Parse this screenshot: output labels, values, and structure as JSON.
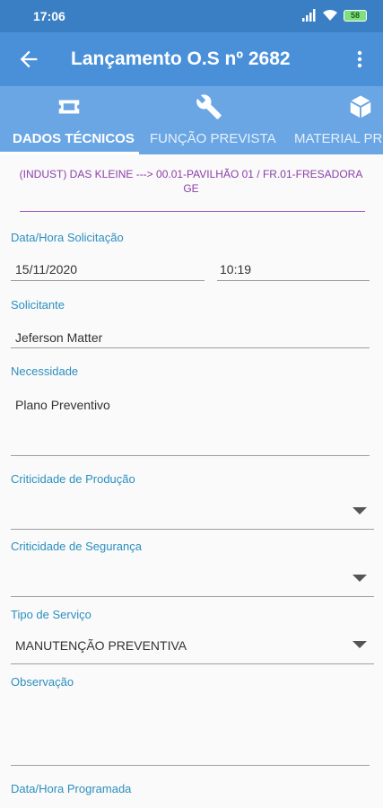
{
  "status_bar": {
    "time": "17:06",
    "battery": "58"
  },
  "app_bar": {
    "title": "Lançamento O.S nº 2682"
  },
  "tabs": [
    {
      "label": "DADOS TÉCNICOS",
      "icon": "ticket-icon"
    },
    {
      "label": "FUNÇÃO PREVISTA",
      "icon": "wrench-icon"
    },
    {
      "label": "MATERIAL PR",
      "icon": "box-icon"
    }
  ],
  "location": {
    "line1": "(INDUST) DAS KLEINE  ---> 00.01-PAVILHÃO 01 / FR.01-FRESADORA",
    "line2": "GE"
  },
  "form": {
    "datetime_label": "Data/Hora Solicitação",
    "date_value": "15/11/2020",
    "time_value": "10:19",
    "requester_label": "Solicitante",
    "requester_value": "Jeferson Matter",
    "need_label": "Necessidade",
    "need_value": "Plano Preventivo",
    "prod_crit_label": "Criticidade de Produção",
    "prod_crit_value": "",
    "safety_crit_label": "Criticidade de Segurança",
    "safety_crit_value": "",
    "service_type_label": "Tipo de Serviço",
    "service_type_value": "MANUTENÇÃO PREVENTIVA",
    "observation_label": "Observação",
    "observation_value": "",
    "scheduled_label": "Data/Hora Programada"
  },
  "colors": {
    "status_bar": "#3a7fc4",
    "app_bar": "#4a90d9",
    "tabs": "#6aa6e4",
    "label": "#2a8fbf",
    "location": "#8b3fa8"
  }
}
